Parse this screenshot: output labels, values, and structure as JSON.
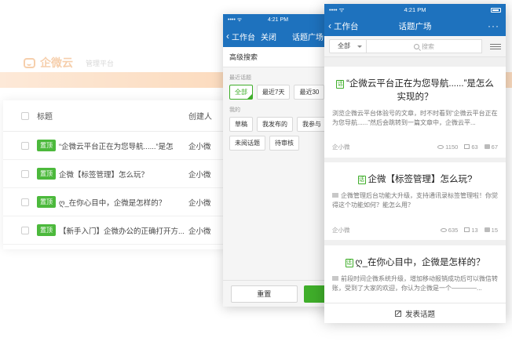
{
  "web": {
    "brand": "企微云",
    "subtitle": "管理平台",
    "table": {
      "col_title": "标题",
      "col_creator": "创建人",
      "rows": [
        {
          "pin": "置顶",
          "title": "“企微云平台正在为您导航......”是怎",
          "creator": "企小微"
        },
        {
          "pin": "置顶",
          "title": "企微【标签管理】怎么玩？",
          "creator": "企小微"
        },
        {
          "pin": "置顶",
          "title": "ღ_在你心目中，企微是怎样的？",
          "creator": "企小微"
        },
        {
          "pin": "置顶",
          "title": "【新手入门】企微办公的正确打开方...",
          "creator": "企小微"
        }
      ]
    }
  },
  "search_phone": {
    "status_time": "4:21 PM",
    "back_label": "工作台",
    "close_label": "关闭",
    "nav_title": "话题广场",
    "advanced_search": "高级搜索",
    "recent_label": "最近话题",
    "recent_options": [
      "全部",
      "最近7天",
      "最近30"
    ],
    "mine_label": "我的",
    "mine_options_row1": [
      "草稿",
      "我发布的",
      "我参与"
    ],
    "mine_options_row2": [
      "未阅话题",
      "待审核"
    ],
    "reset_label": "重置"
  },
  "plaza_phone": {
    "status_time": "4:21 PM",
    "back_label": "工作台",
    "nav_title": "话题广场",
    "more_icon": "···",
    "filter_value": "全部",
    "search_placeholder": "搜索",
    "topics": [
      {
        "title": "“企微云平台正在为您导航......”是怎么实现的？",
        "body": "浏览企微云平台体验号的文章，时不时看到“企微云平台正在为您导航......”然后会跳转到一篇文章中，企微云平...",
        "author": "企小微",
        "views": "1150",
        "comments": "63",
        "likes": "67"
      },
      {
        "title": "企微【标签管理】怎么玩?",
        "body": "企微管理后台功能大升级，支持通讯录标签管理啦！你觉得这个功能如何？能怎么用？",
        "author": "企小微",
        "views": "635",
        "comments": "13",
        "likes": "15"
      },
      {
        "title": "ღ_在你心目中，企微是怎样的？",
        "body": "前段时间企微系统升级，增加移动报销成功后可以微信转账，受到了大家的欢迎，你认为企微是一个————...",
        "author": "",
        "views": "",
        "comments": "",
        "likes": ""
      }
    ],
    "publish_label": "发表话题"
  }
}
